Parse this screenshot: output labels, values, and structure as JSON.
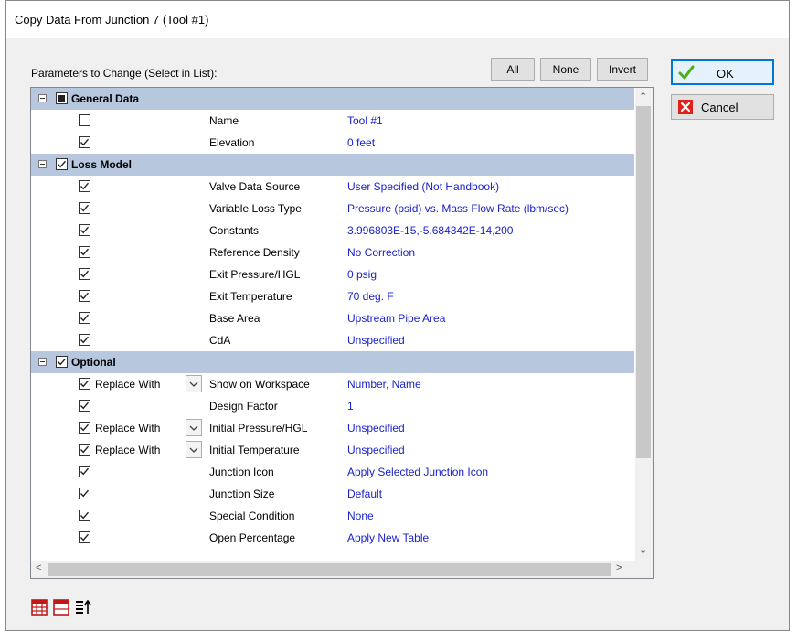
{
  "window": {
    "title": "Copy Data From Junction 7 (Tool #1)"
  },
  "params_label": "Parameters to Change (Select in List):",
  "select_buttons": {
    "all": "All",
    "none": "None",
    "invert": "Invert"
  },
  "buttons": {
    "ok": "OK",
    "cancel": "Cancel"
  },
  "replace_label": "Replace With",
  "rows": [
    {
      "kind": "category",
      "name": "General Data",
      "check": "partial"
    },
    {
      "kind": "param",
      "checked": false,
      "name": "Name",
      "value": "Tool #1"
    },
    {
      "kind": "param",
      "checked": true,
      "name": "Elevation",
      "value": "0 feet"
    },
    {
      "kind": "category",
      "name": "Loss Model",
      "check": "checked"
    },
    {
      "kind": "param",
      "checked": true,
      "name": "Valve Data Source",
      "value": "User Specified (Not Handbook)"
    },
    {
      "kind": "param",
      "checked": true,
      "name": "Variable Loss Type",
      "value": "Pressure (psid) vs. Mass Flow Rate (lbm/sec)"
    },
    {
      "kind": "param",
      "checked": true,
      "name": "Constants",
      "value": "3.996803E-15,-5.684342E-14,200"
    },
    {
      "kind": "param",
      "checked": true,
      "name": "Reference Density",
      "value": "No Correction"
    },
    {
      "kind": "param",
      "checked": true,
      "name": "Exit Pressure/HGL",
      "value": "0 psig"
    },
    {
      "kind": "param",
      "checked": true,
      "name": "Exit Temperature",
      "value": "70 deg. F"
    },
    {
      "kind": "param",
      "checked": true,
      "name": "Base Area",
      "value": "Upstream Pipe Area"
    },
    {
      "kind": "param",
      "checked": true,
      "name": "CdA",
      "value": "Unspecified"
    },
    {
      "kind": "category",
      "name": "Optional",
      "check": "checked"
    },
    {
      "kind": "param",
      "checked": true,
      "replace": true,
      "name": "Show on Workspace",
      "value": "Number, Name"
    },
    {
      "kind": "param",
      "checked": true,
      "name": "Design Factor",
      "value": "1"
    },
    {
      "kind": "param",
      "checked": true,
      "replace": true,
      "name": "Initial Pressure/HGL",
      "value": "Unspecified"
    },
    {
      "kind": "param",
      "checked": true,
      "replace": true,
      "name": "Initial Temperature",
      "value": "Unspecified"
    },
    {
      "kind": "param",
      "checked": true,
      "name": "Junction Icon",
      "value": "Apply Selected Junction Icon"
    },
    {
      "kind": "param",
      "checked": true,
      "name": "Junction Size",
      "value": "Default"
    },
    {
      "kind": "param",
      "checked": true,
      "name": "Special Condition",
      "value": "None"
    },
    {
      "kind": "param",
      "checked": true,
      "name": "Open Percentage",
      "value": "Apply New Table"
    }
  ],
  "toolbar": [
    "table-grid-icon",
    "table-header-icon",
    "sort-order-icon"
  ],
  "colors": {
    "category_bg": "#b7c7dd",
    "value_text": "#1a22cc",
    "ok_border": "#0078d7",
    "ok_check": "#4caf1a",
    "cancel_x": "#e0201b"
  }
}
